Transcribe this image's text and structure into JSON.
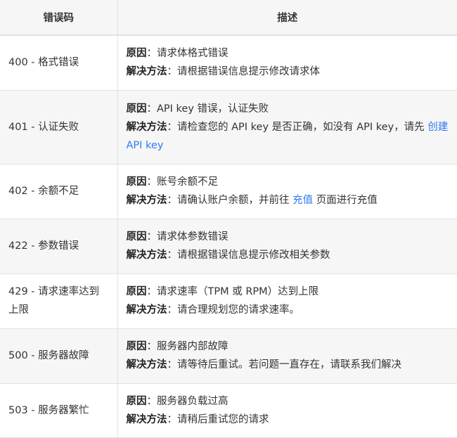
{
  "headers": {
    "code": "错误码",
    "desc": "描述"
  },
  "reason_label": "原因",
  "solution_label": "解决方法",
  "colon": "：",
  "rows": [
    {
      "code": "400 - 格式错误",
      "reason": "请求体格式错误",
      "solution": "请根据错误信息提示修改请求体"
    },
    {
      "code": "401 - 认证失败",
      "reason": "API key 错误，认证失败",
      "solution": "请检查您的 API key 是否正确，如没有 API key，请先 ",
      "link": "创建 API key",
      "solution_after": ""
    },
    {
      "code": "402 - 余额不足",
      "reason": "账号余额不足",
      "solution": "请确认账户余额，并前往 ",
      "link": "充值",
      "solution_after": " 页面进行充值"
    },
    {
      "code": "422 - 参数错误",
      "reason": "请求体参数错误",
      "solution": "请根据错误信息提示修改相关参数"
    },
    {
      "code": "429 - 请求速率达到上限",
      "reason": "请求速率（TPM 或 RPM）达到上限",
      "solution": "请合理规划您的请求速率。"
    },
    {
      "code": "500 - 服务器故障",
      "reason": "服务器内部故障",
      "solution": "请等待后重试。若问题一直存在，请联系我们解决"
    },
    {
      "code": "503 - 服务器繁忙",
      "reason": "服务器负载过高",
      "solution": "请稍后重试您的请求"
    }
  ],
  "colors": {
    "link": "#2f7bf0",
    "header_bg": "#f6f6f6",
    "border": "#dfe2e5"
  }
}
